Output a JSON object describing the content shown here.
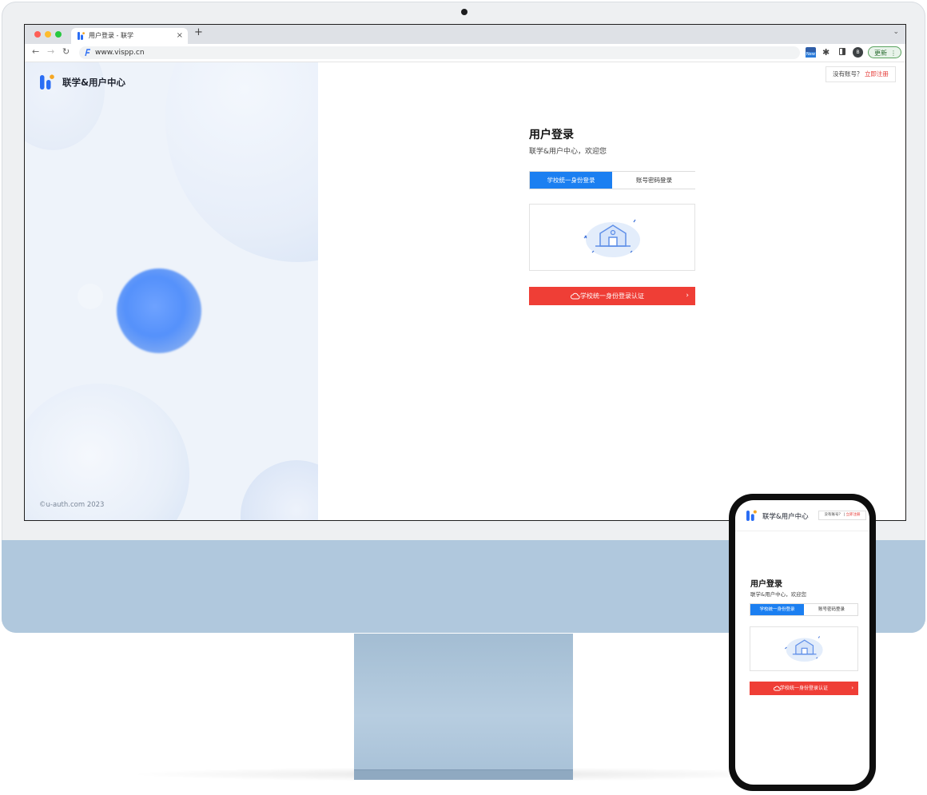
{
  "browser": {
    "tab_title": "用户登录 - 联学",
    "tab_close": "×",
    "new_tab": "+",
    "tab_menu": "⌄",
    "url": "www.vispp.cn",
    "nav_back": "←",
    "nav_forward": "→",
    "nav_reload": "↻",
    "extension_badge": "New",
    "avatar_initial": "B",
    "update_label": "更新",
    "update_menu": "⋮"
  },
  "brand": {
    "name": "联学&用户中心",
    "copyright": "©u-auth.com 2023"
  },
  "register": {
    "prompt": "没有账号？",
    "link": "立即注册"
  },
  "login": {
    "title": "用户登录",
    "subtitle": "联学&用户中心，欢迎您",
    "tabs": [
      "学校统一身份登录",
      "账号密码登录"
    ],
    "active_tab": "学校统一身份登录",
    "auth_button": "学校统一身份登录认证",
    "auth_chevron": "›"
  },
  "phone": {
    "brand_name": "联学&用户中心",
    "register_prompt": "没有账号？",
    "register_separator": "|",
    "register_link": "立即注册",
    "title": "用户登录",
    "subtitle": "联学&用户中心，欢迎您",
    "tabs": [
      "学校统一身份登录",
      "账号密码登录"
    ],
    "auth_button": "学校统一身份登录认证",
    "auth_chevron": "›"
  },
  "colors": {
    "primary_blue": "#1b7ff1",
    "auth_red": "#ef3e36",
    "register_red": "#e53935",
    "imac_chin": "#b0c8dd",
    "update_green": "#2d6e33"
  }
}
